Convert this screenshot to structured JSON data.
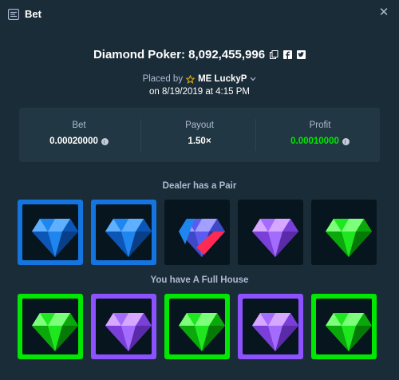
{
  "header": {
    "title": "Bet",
    "icon": "bet-icon",
    "close_icon": "close-icon"
  },
  "game": {
    "title": "Diamond Poker: 8,092,455,996",
    "icons": [
      "copy-icon",
      "facebook-icon",
      "twitter-icon"
    ]
  },
  "placed_by": {
    "prefix": "Placed by",
    "user": "ME LuckyP",
    "date": "on 8/19/2019 at 4:15 PM"
  },
  "stats": {
    "bet": {
      "label": "Bet",
      "value": "0.00020000"
    },
    "payout": {
      "label": "Payout",
      "value": "1.50×"
    },
    "profit": {
      "label": "Profit",
      "value": "0.00010000"
    }
  },
  "dealer": {
    "label": "Dealer has a Pair",
    "gems": [
      {
        "color": "blue",
        "highlight": true
      },
      {
        "color": "blue",
        "highlight": true
      },
      {
        "color": "tricolor",
        "highlight": false
      },
      {
        "color": "purple",
        "highlight": false
      },
      {
        "color": "green",
        "highlight": false
      }
    ]
  },
  "player": {
    "label": "You have A Full House",
    "gems": [
      {
        "color": "green",
        "highlight": true
      },
      {
        "color": "purple",
        "highlight": true
      },
      {
        "color": "green",
        "highlight": true
      },
      {
        "color": "purple",
        "highlight": true
      },
      {
        "color": "green",
        "highlight": true
      }
    ]
  },
  "colors": {
    "blue": "#1475e1",
    "green": "#00e701",
    "purple": "#8c52ff",
    "background": "#1a2c38",
    "panel": "#213743"
  }
}
